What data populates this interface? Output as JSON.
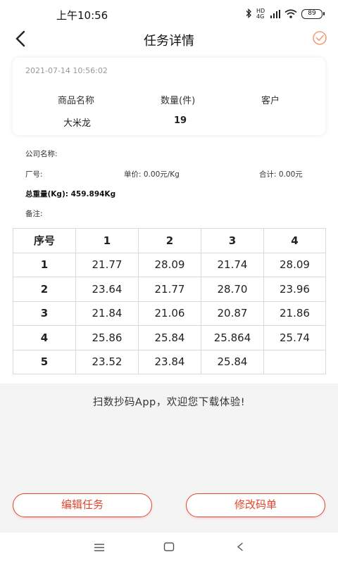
{
  "status_bar": {
    "time": "上午10:56",
    "network_label": "HD 4G",
    "battery": "89",
    "icons": [
      "bluetooth-icon",
      "signal-icon",
      "wifi-icon",
      "battery-icon"
    ]
  },
  "header": {
    "title": "任务详情",
    "back_icon": "chevron-left-icon",
    "action_icon": "check-circle-icon"
  },
  "card": {
    "datetime": "2021-07-14 10:56:02",
    "columns": [
      "商品名称",
      "数量(件)",
      "客户"
    ],
    "product": "大米龙",
    "quantity": "19",
    "customer": ""
  },
  "info": {
    "company_label": "公司名称:",
    "factory_label": "厂号:",
    "unit_price": "单价: 0.00元/Kg",
    "total": "合计: 0.00元",
    "total_weight": "总重量(Kg): 459.894Kg",
    "note_label": "备注:"
  },
  "table": {
    "headers": [
      "序号",
      "1",
      "2",
      "3",
      "4"
    ],
    "rows": [
      [
        "1",
        "21.77",
        "28.09",
        "21.74",
        "28.09"
      ],
      [
        "2",
        "23.64",
        "21.77",
        "28.70",
        "23.96"
      ],
      [
        "3",
        "21.84",
        "21.06",
        "20.87",
        "21.86"
      ],
      [
        "4",
        "25.86",
        "25.84",
        "25.864",
        "25.74"
      ],
      [
        "5",
        "23.52",
        "23.84",
        "25.84",
        ""
      ]
    ]
  },
  "footer": {
    "welcome": "扫数抄码App，欢迎您下载体验!"
  },
  "buttons": {
    "edit_task": "编辑任务",
    "modify_code": "修改码单"
  },
  "colors": {
    "accent": "#e2452b",
    "check_icon": "#f0a078"
  },
  "nav_bar": {
    "icons": [
      "menu-icon",
      "home-square-icon",
      "back-triangle-icon"
    ]
  }
}
